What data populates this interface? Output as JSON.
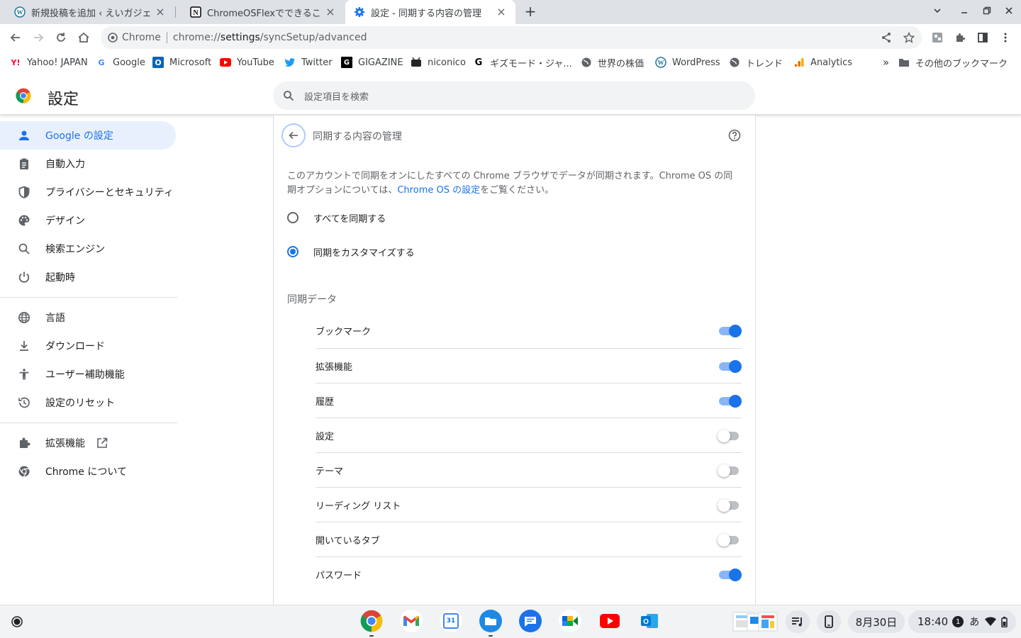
{
  "tabs": [
    {
      "title": "新規投稿を追加 ‹ えいガジェ",
      "active": false
    },
    {
      "title": "ChromeOSFlexでできること",
      "active": false
    },
    {
      "title": "設定 - 同期する内容の管理",
      "active": true
    }
  ],
  "toolbar": {
    "site_name": "Chrome",
    "url_prefix": "chrome://",
    "url_host": "settings",
    "url_path": "/syncSetup/advanced"
  },
  "bookmarks": [
    {
      "label": "Yahoo! JAPAN",
      "icon": "yahoo-icon"
    },
    {
      "label": "Google",
      "icon": "google-icon"
    },
    {
      "label": "Microsoft",
      "icon": "outlook-icon"
    },
    {
      "label": "YouTube",
      "icon": "youtube-icon"
    },
    {
      "label": "Twitter",
      "icon": "twitter-icon"
    },
    {
      "label": "GIGAZINE",
      "icon": "gigazine-icon"
    },
    {
      "label": "niconico",
      "icon": "niconico-icon"
    },
    {
      "label": "ギズモード・ジャ...",
      "icon": "gizmodo-icon"
    },
    {
      "label": "世界の株価",
      "icon": "globe-icon"
    },
    {
      "label": "WordPress",
      "icon": "wordpress-icon"
    },
    {
      "label": "トレンド",
      "icon": "globe-icon"
    },
    {
      "label": "Analytics",
      "icon": "analytics-icon"
    }
  ],
  "bookmarks_overflow": "»",
  "other_bookmarks": "その他のブックマーク",
  "settings": {
    "title": "設定",
    "search_placeholder": "設定項目を検索"
  },
  "nav": [
    {
      "label": "Google の設定",
      "icon": "person-icon",
      "active": true
    },
    {
      "label": "自動入力",
      "icon": "clipboard-icon",
      "active": false
    },
    {
      "label": "プライバシーとセキュリティ",
      "icon": "shield-icon",
      "active": false
    },
    {
      "label": "デザイン",
      "icon": "palette-icon",
      "active": false
    },
    {
      "label": "検索エンジン",
      "icon": "search-icon",
      "active": false
    },
    {
      "label": "起動時",
      "icon": "power-icon",
      "active": false
    },
    {
      "label": "言語",
      "icon": "globe-icon",
      "active": false
    },
    {
      "label": "ダウンロード",
      "icon": "download-icon",
      "active": false
    },
    {
      "label": "ユーザー補助機能",
      "icon": "accessibility-icon",
      "active": false
    },
    {
      "label": "設定のリセット",
      "icon": "reset-icon",
      "active": false
    },
    {
      "label": "拡張機能",
      "icon": "extension-icon",
      "active": false
    },
    {
      "label": "Chrome について",
      "icon": "chrome-icon",
      "active": false
    }
  ],
  "page": {
    "title": "同期する内容の管理",
    "description_before": "このアカウントで同期をオンにしたすべての Chrome ブラウザでデータが同期されます。Chrome OS の同期オプションについては、",
    "description_link": "Chrome OS の設定",
    "description_after": "をご覧ください。",
    "radio_sync_all": "すべてを同期する",
    "radio_customize": "同期をカスタマイズする",
    "selected_radio": "customize",
    "section_label": "同期データ",
    "sync_items": [
      {
        "label": "ブックマーク",
        "on": true
      },
      {
        "label": "拡張機能",
        "on": true
      },
      {
        "label": "履歴",
        "on": true
      },
      {
        "label": "設定",
        "on": false
      },
      {
        "label": "テーマ",
        "on": false
      },
      {
        "label": "リーディング リスト",
        "on": false
      },
      {
        "label": "開いているタブ",
        "on": false
      },
      {
        "label": "パスワード",
        "on": true
      }
    ]
  },
  "shelf": {
    "apps": [
      "chrome-icon",
      "gmail-icon",
      "calendar-icon",
      "files-icon",
      "messages-icon",
      "meet-icon",
      "youtube-icon",
      "outlook-icon"
    ],
    "calendar_day": "31",
    "date": "8月30日",
    "time": "18:40",
    "notification_count": "1",
    "ime": "あ"
  },
  "colors": {
    "accent": "#1a73e8",
    "toggle_track_on": "#8ab4f8",
    "toggle_track_off": "#bdc1c6",
    "nav_active_bg": "#e8f0fe"
  }
}
